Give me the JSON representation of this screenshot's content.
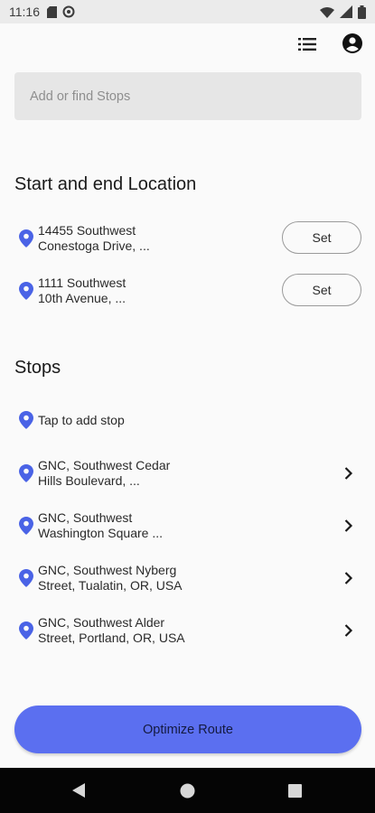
{
  "status_bar": {
    "time": "11:16",
    "left_icons": [
      "sd-card-icon",
      "vpn-icon"
    ],
    "right_icons": [
      "wifi-icon",
      "signal-icon",
      "battery-icon"
    ]
  },
  "appbar": {
    "icons": [
      "list-icon",
      "account-circle-icon"
    ]
  },
  "search": {
    "placeholder": "Add or find Stops"
  },
  "start_end": {
    "title": "Start and end Location",
    "items": [
      {
        "line1": "14455 Southwest",
        "line2": "Conestoga Drive, ...",
        "button": "Set"
      },
      {
        "line1": "1111 Southwest",
        "line2": "10th Avenue, ...",
        "button": "Set"
      }
    ]
  },
  "stops": {
    "title": "Stops",
    "add_label": "Tap to add stop",
    "items": [
      {
        "line1": "GNC, Southwest Cedar",
        "line2": "Hills Boulevard, ..."
      },
      {
        "line1": "GNC, Southwest",
        "line2": "Washington Square ..."
      },
      {
        "line1": "GNC, Southwest Nyberg",
        "line2": "Street, Tualatin, OR, USA"
      },
      {
        "line1": "GNC, Southwest Alder",
        "line2": "Street, Portland, OR, USA"
      }
    ]
  },
  "actions": {
    "optimize_label": "Optimize Route"
  },
  "colors": {
    "accent": "#5b6ff0",
    "pin": "#4a63e6",
    "search_bg": "#e6e6e6",
    "status_bg": "#ebebeb",
    "nav_bg": "#050505"
  }
}
